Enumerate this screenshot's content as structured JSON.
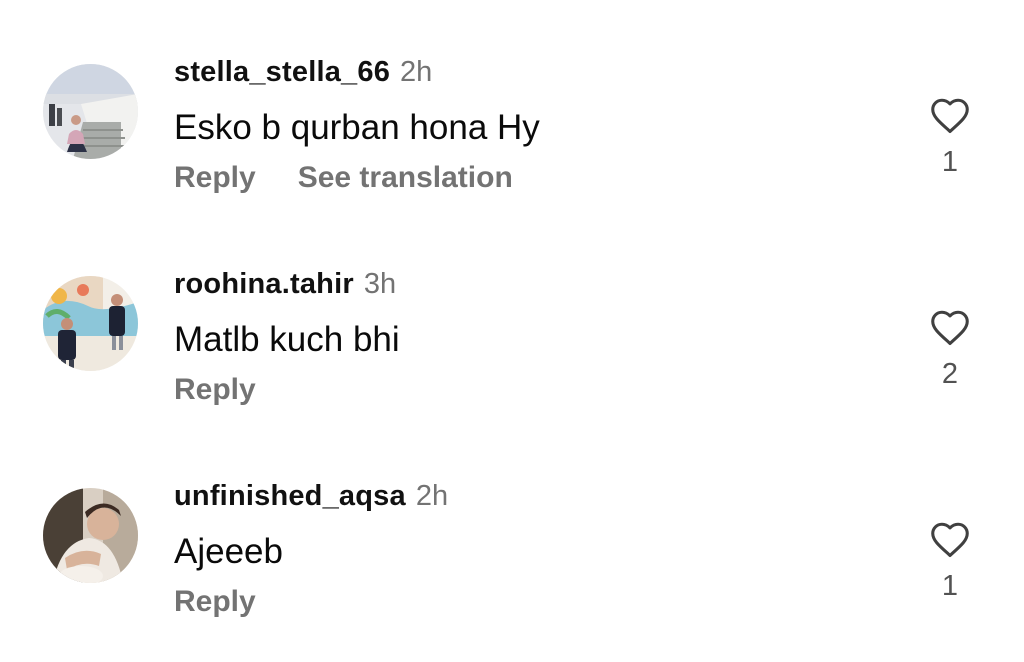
{
  "comments": [
    {
      "username": "stella_stella_66",
      "time": "2h",
      "text": "Esko b qurban hona Hy",
      "reply_label": "Reply",
      "translation_label": "See translation",
      "likes": "1",
      "avatar_icon": "profile-photo"
    },
    {
      "username": "roohina.tahir",
      "time": "3h",
      "text": "Matlb kuch bhi",
      "reply_label": "Reply",
      "likes": "2",
      "avatar_icon": "profile-photo"
    },
    {
      "username": "unfinished_aqsa",
      "time": "2h",
      "text": "Ajeeeb",
      "reply_label": "Reply",
      "likes": "1",
      "avatar_icon": "profile-photo"
    }
  ],
  "colors": {
    "text": "#0a0a0a",
    "secondary": "#737373",
    "icon": "#525252"
  }
}
